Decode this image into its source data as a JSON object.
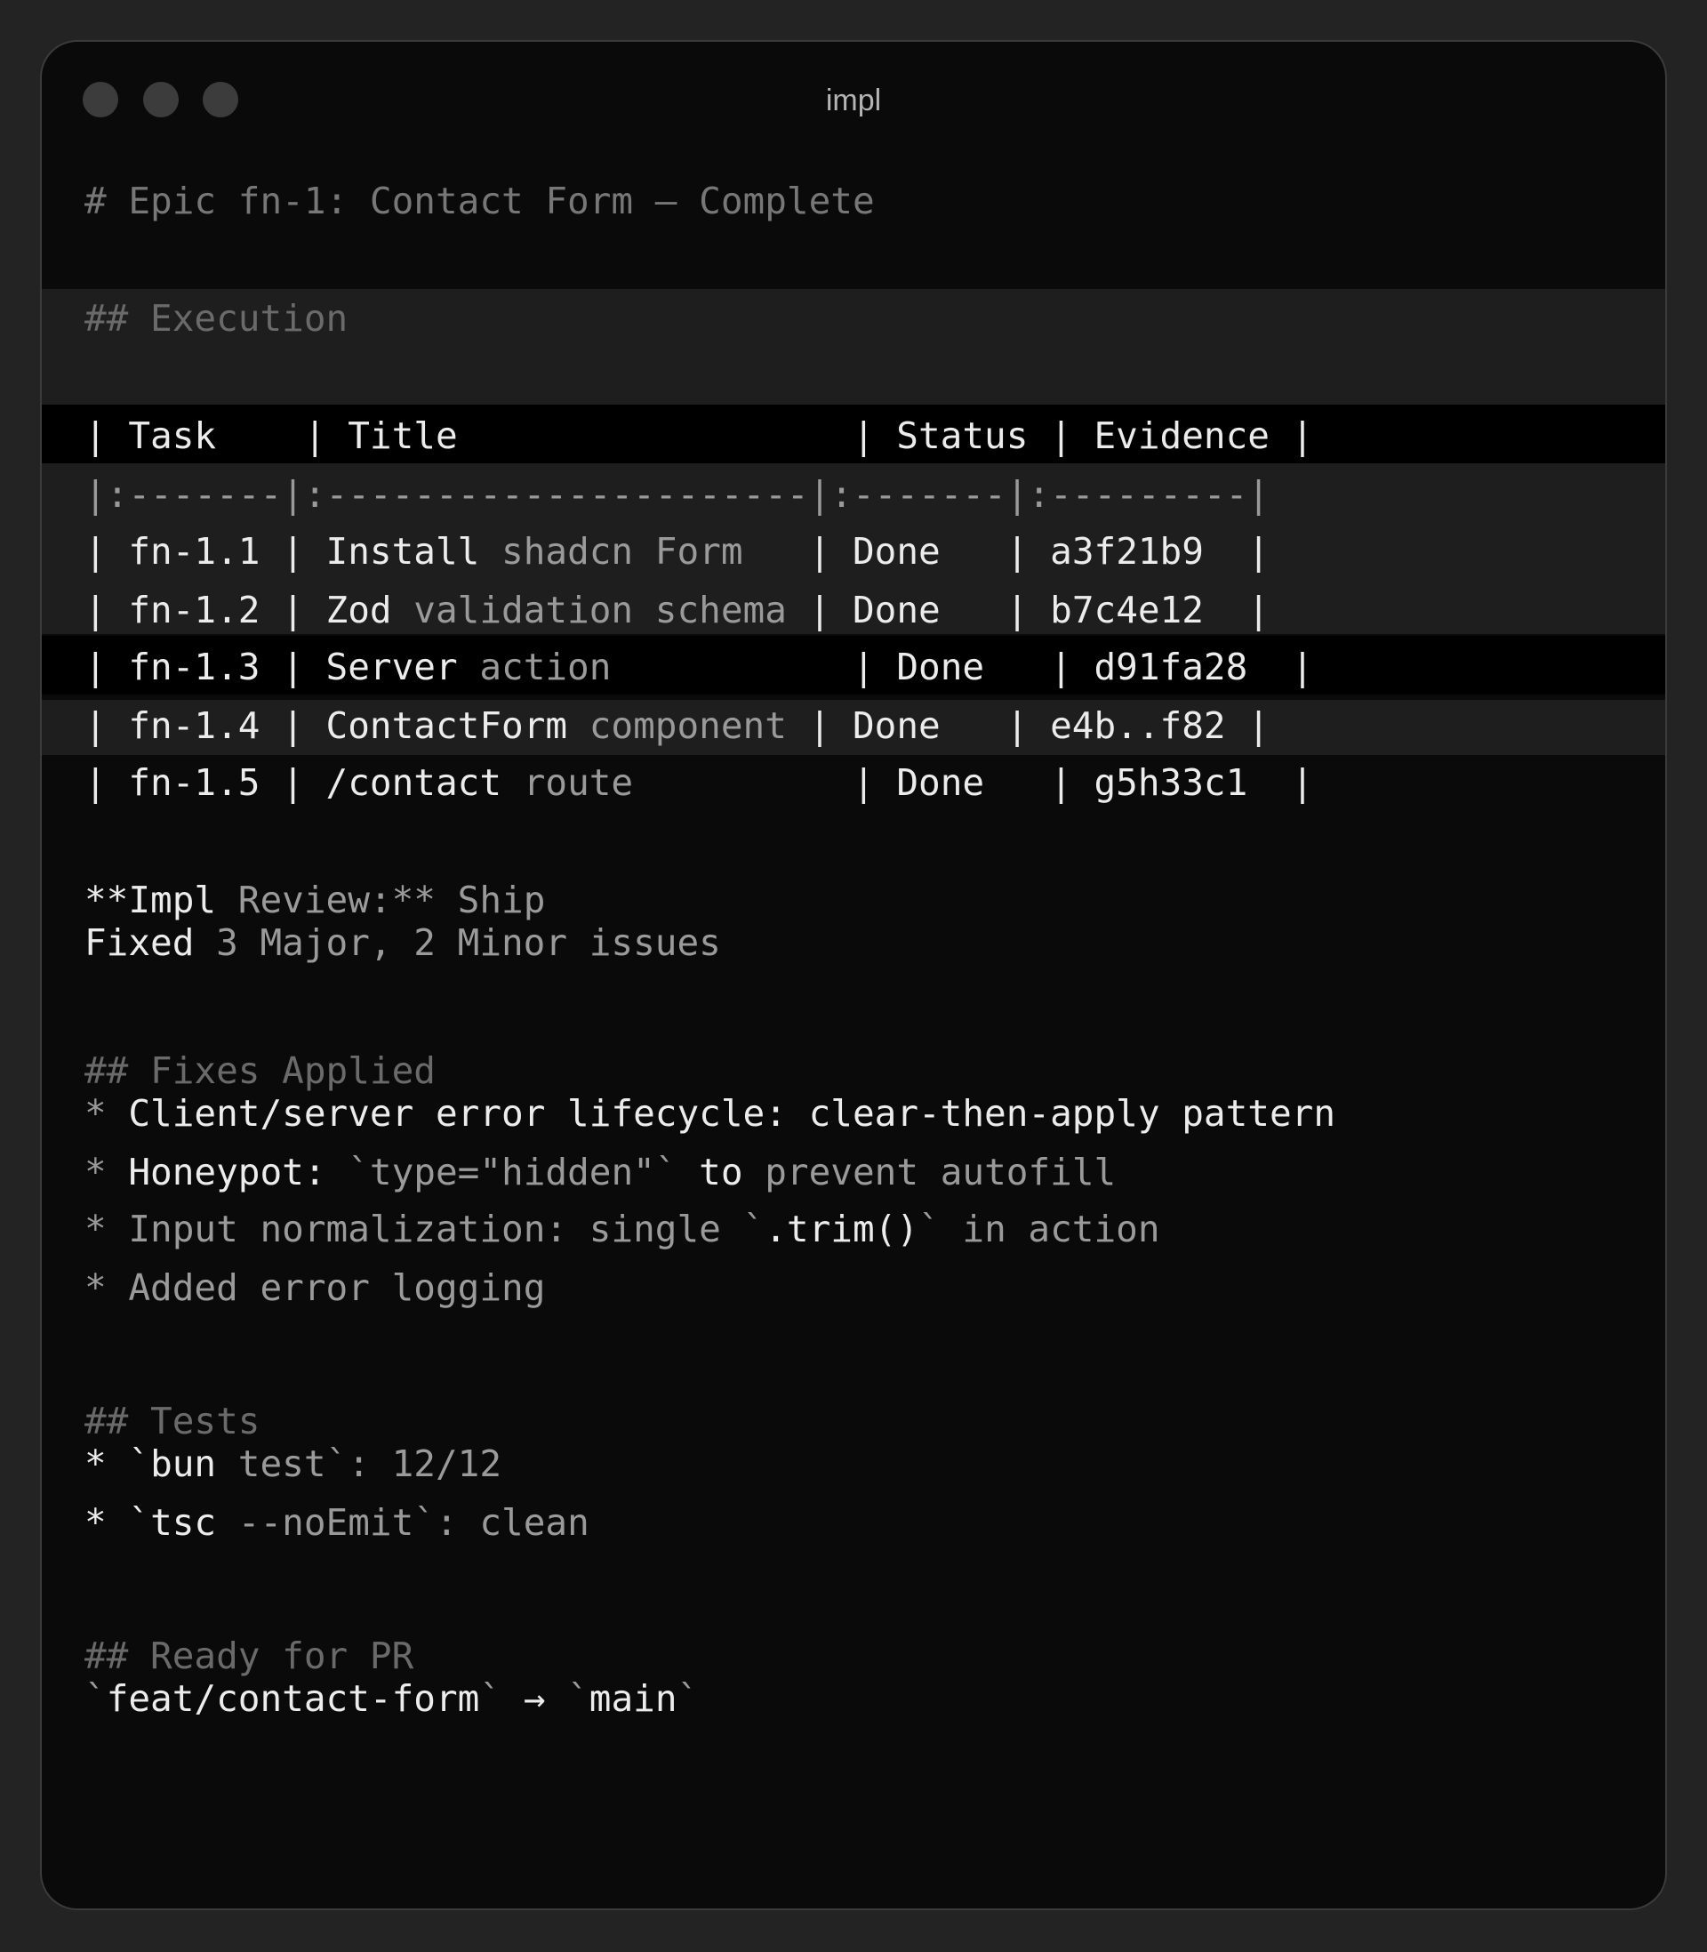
{
  "window": {
    "title": "impl",
    "controls": [
      "close-dot",
      "minimize-dot",
      "zoom-dot"
    ]
  },
  "doc": {
    "heading": "# Epic fn-1: Contact Form — Complete",
    "execution_heading": "## Execution",
    "table_header": "| Task    | Title                  | Status | Evidence |",
    "table_sep": "|:-------|:----------------------|:-------|:---------|",
    "table_rows": [
      {
        "pre": "| fn-1.1 | ",
        "w1": "Install",
        "g1": " shadcn Form",
        "pad": "   ",
        "status": "| Done   | ",
        "evidence": "a3f21b9  |"
      },
      {
        "pre": "| fn-1.2 | ",
        "w1": "Zod",
        "g1": " validation schema",
        "pad": " ",
        "status": "| Done   | ",
        "evidence": "b7c4e12  |"
      },
      {
        "pre": "| fn-1.3 | ",
        "w1": "Server",
        "g1": " action",
        "pad": "           ",
        "status": "| Done   | ",
        "evidence": "d91fa28  |"
      },
      {
        "pre": "| fn-1.4 | ",
        "w1": "ContactForm",
        "g1": " component",
        "pad": " ",
        "status": "| Done   | ",
        "evidence": "e4b..f82 |"
      },
      {
        "pre": "| fn-1.5 | ",
        "w1": "/contact",
        "g1": " route",
        "pad": "          ",
        "status": "| Done   | ",
        "evidence": "g5h33c1  |"
      }
    ],
    "review_line": {
      "w": "**Impl",
      "g": " Review:**",
      "w2": " Ship"
    },
    "fixed_line": {
      "w": "Fixed",
      "g": " 3 Major, 2 Minor issues"
    },
    "fixes_heading": "## Fixes Applied",
    "fixes": [
      {
        "bullet": "* ",
        "w": "Client/server error lifecycle: clear-then-apply pattern",
        "g": ""
      },
      {
        "bullet": "* ",
        "w": "Honeypot:",
        "g": " `type=\"hidden\"`",
        "w2": " to",
        "g2": " prevent autofill"
      },
      {
        "bullet": "* ",
        "w": "",
        "g": "Input normalization: single `",
        "w2": ".trim()",
        "g2": "` in action"
      },
      {
        "bullet": "* ",
        "w": "",
        "g": "Added error logging"
      }
    ],
    "tests_heading": "## Tests",
    "tests": [
      {
        "bullet": "* `",
        "w": "bun",
        "g": " test`: 12/12"
      },
      {
        "bullet": "* `",
        "w": "tsc",
        "g": " --noEmit`: clean"
      }
    ],
    "pr_heading": "## Ready for PR",
    "pr_line": {
      "g1": "`",
      "w1": "feat/contact-form",
      "g2": "` ",
      "w2": "→",
      "g3": " `",
      "w3": "main",
      "g4": "`"
    }
  },
  "colors": {
    "page_bg": "#232323",
    "window_bg": "#0a0a0a",
    "highlight_band": "#1e1e1e",
    "text_bright": "#ececec",
    "text_dim": "#9a9a9a",
    "heading": "#6a6a6a"
  }
}
